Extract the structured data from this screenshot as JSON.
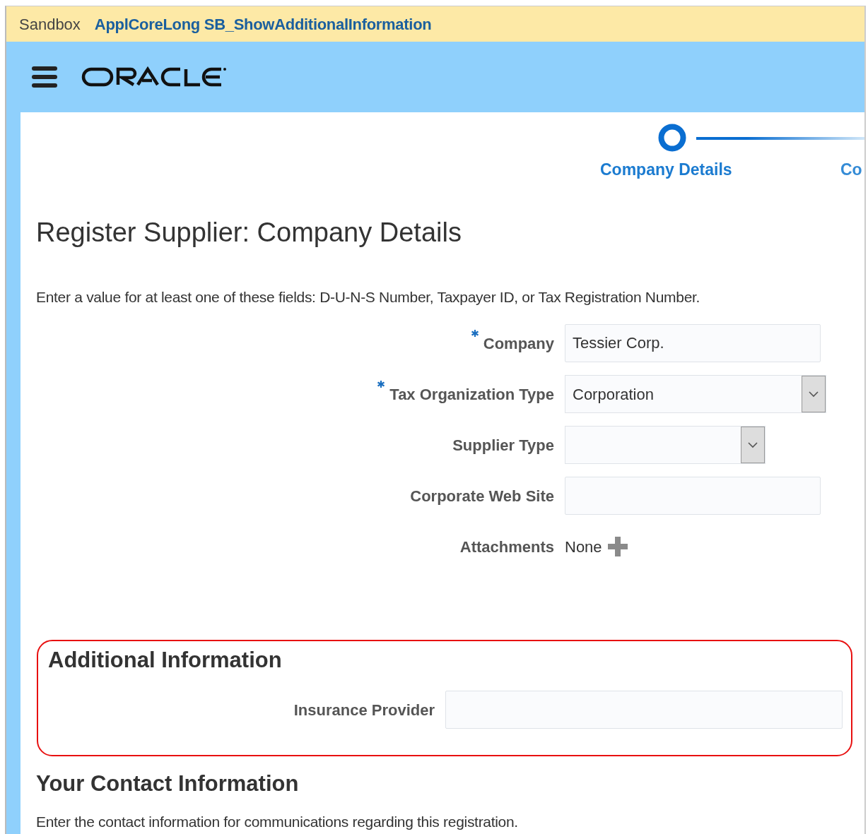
{
  "sandbox_bar": {
    "label": "Sandbox",
    "name": "ApplCoreLong SB_ShowAdditionalInformation"
  },
  "train": [
    {
      "label": "Company Details",
      "selected": true
    },
    {
      "label": "Co",
      "selected": false
    }
  ],
  "title": "Register Supplier: Company Details",
  "instruction": "Enter a value for at least one of these fields: D-U-N-S Number, Taxpayer ID, or Tax Registration Number.",
  "fields": [
    {
      "kind": "text",
      "label": "Company",
      "required": true,
      "value": "Tessier Corp."
    },
    {
      "kind": "select",
      "label": "Tax Organization Type",
      "required": true,
      "value": "Corporation"
    },
    {
      "kind": "compact_select",
      "label": "Supplier Type",
      "required": false
    },
    {
      "kind": "text",
      "label": "Corporate Web Site",
      "required": false
    },
    {
      "kind": "attachments",
      "label": "Attachments",
      "required": false,
      "value": "None"
    }
  ],
  "additional_information": {
    "heading": "Additional Information",
    "highlighted": true,
    "fields": [
      {
        "kind": "text",
        "label": "Insurance Provider",
        "required": false
      }
    ]
  },
  "contact_section": {
    "heading": "Your Contact Information",
    "text": "Enter the contact information for communications regarding this registration."
  }
}
